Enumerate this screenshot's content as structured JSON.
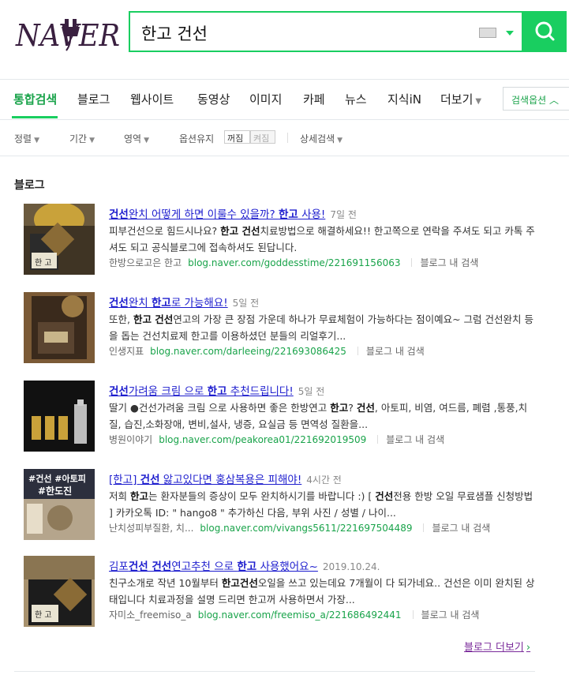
{
  "header": {
    "logo_text": "NAVER",
    "query": "한고 건선"
  },
  "tabs": [
    {
      "label": "통합검색"
    },
    {
      "label": "블로그"
    },
    {
      "label": "웹사이트"
    },
    {
      "label": "동영상"
    },
    {
      "label": "이미지"
    },
    {
      "label": "카페"
    },
    {
      "label": "뉴스"
    },
    {
      "label": "지식iN"
    },
    {
      "label": "더보기"
    }
  ],
  "search_option_label": "검색옵션",
  "filters": {
    "sort": "정렬",
    "period": "기간",
    "area": "영역",
    "keep_option": "옵션유지",
    "off": "꺼짐",
    "on": "켜짐",
    "detail": "상세검색"
  },
  "section_title": "블로그",
  "results": [
    {
      "title_parts": [
        {
          "t": "건선",
          "b": true
        },
        {
          "t": "완치 어떻게 하면 이룰수 있을까? ",
          "b": false
        },
        {
          "t": "한고",
          "b": true
        },
        {
          "t": " 사용!",
          "b": false
        }
      ],
      "date": "7일 전",
      "desc_parts": [
        {
          "t": "피부건선으로 힘드시나요? ",
          "b": false
        },
        {
          "t": "한고 건선",
          "b": true
        },
        {
          "t": "치료방법으로 해결하세요!! 한고쪽으로 연락을 주셔도 되고 카톡 주셔도 되고 공식블로그에 접속하셔도 된답니다.",
          "b": false
        }
      ],
      "blog_name": "한방으로고은 한고",
      "url": "blog.naver.com/goddesstime/221691156063",
      "blog_search": "블로그 내 검색",
      "thumb_label": "한 고"
    },
    {
      "title_parts": [
        {
          "t": "건선",
          "b": true
        },
        {
          "t": "완치 ",
          "b": false
        },
        {
          "t": "한고",
          "b": true
        },
        {
          "t": "로 가능해요!",
          "b": false
        }
      ],
      "date": "5일 전",
      "desc_parts": [
        {
          "t": "또한, ",
          "b": false
        },
        {
          "t": "한고 건선",
          "b": true
        },
        {
          "t": "연고의 가장 큰 장점 가운데 하나가 무료체험이 가능하다는 점이예요~ 그럼 건선완치 등을 돕는 건선치료제 한고를 이용하셨던 분들의 리얼후기...",
          "b": false
        }
      ],
      "blog_name": "인생지표",
      "url": "blog.naver.com/darleeing/221693086425",
      "blog_search": "블로그 내 검색",
      "thumb_label": ""
    },
    {
      "title_parts": [
        {
          "t": "건선",
          "b": true
        },
        {
          "t": "가려움 크림 으로 ",
          "b": false
        },
        {
          "t": "한고",
          "b": true
        },
        {
          "t": " 추천드립니다!",
          "b": false
        }
      ],
      "date": "5일 전",
      "desc_parts": [
        {
          "t": "딸기 ●건선가려움 크림 으로 사용하면 좋은 한방연고 ",
          "b": false
        },
        {
          "t": "한고",
          "b": true
        },
        {
          "t": "? ",
          "b": false
        },
        {
          "t": "건선",
          "b": true
        },
        {
          "t": ", 아토피, 비염, 여드름, 폐렴 ,통풍,치질, 습진,소화장애, 변비,설사, 냉증, 요실금 등 면역성 질환을...",
          "b": false
        }
      ],
      "blog_name": "병원이야기",
      "url": "blog.naver.com/peakorea01/221692019509",
      "blog_search": "블로그 내 검색",
      "thumb_label": ""
    },
    {
      "title_parts": [
        {
          "t": "[한고] ",
          "b": false
        },
        {
          "t": "건선",
          "b": true
        },
        {
          "t": " 앓고있다면 홍삼복용은 피해야!",
          "b": false
        }
      ],
      "date": "4시간 전",
      "desc_parts": [
        {
          "t": "저희 ",
          "b": false
        },
        {
          "t": "한고",
          "b": true
        },
        {
          "t": "는 환자분들의 증상이 모두 완치하시기를 바랍니다 :) [ ",
          "b": false
        },
        {
          "t": "건선",
          "b": true
        },
        {
          "t": "전용 한방 오일 무료샘플 신청방법 ] 카카오톡 ID: \" hango8 \" 추가하신 다음, 부위 사진 / 성별 / 나이...",
          "b": false
        }
      ],
      "blog_name": "난치성피부질환, 치...",
      "url": "blog.naver.com/vivangs5611/221697504489",
      "blog_search": "블로그 내 검색",
      "thumb_label": "#건선 #아토피 #한도진"
    },
    {
      "title_parts": [
        {
          "t": "김포",
          "b": false
        },
        {
          "t": "건선 건선",
          "b": true
        },
        {
          "t": "연고추천 으로 ",
          "b": false
        },
        {
          "t": "한고",
          "b": true
        },
        {
          "t": " 사용했어요~",
          "b": false
        }
      ],
      "date": "2019.10.24.",
      "desc_parts": [
        {
          "t": "친구소개로 작년 10월부터 ",
          "b": false
        },
        {
          "t": "한고건선",
          "b": true
        },
        {
          "t": "오일을 쓰고 있는데요 7개월이 다 되가네요.. 건선은 이미 완치된 상태입니다 치료과정을 설명 드리면 한고꺼 사용하면서 가장...",
          "b": false
        }
      ],
      "blog_name": "자미소_freemiso_a",
      "url": "blog.naver.com/freemiso_a/221686492441",
      "blog_search": "블로그 내 검색",
      "thumb_label": "한 고"
    }
  ],
  "more_link": "블로그 더보기"
}
